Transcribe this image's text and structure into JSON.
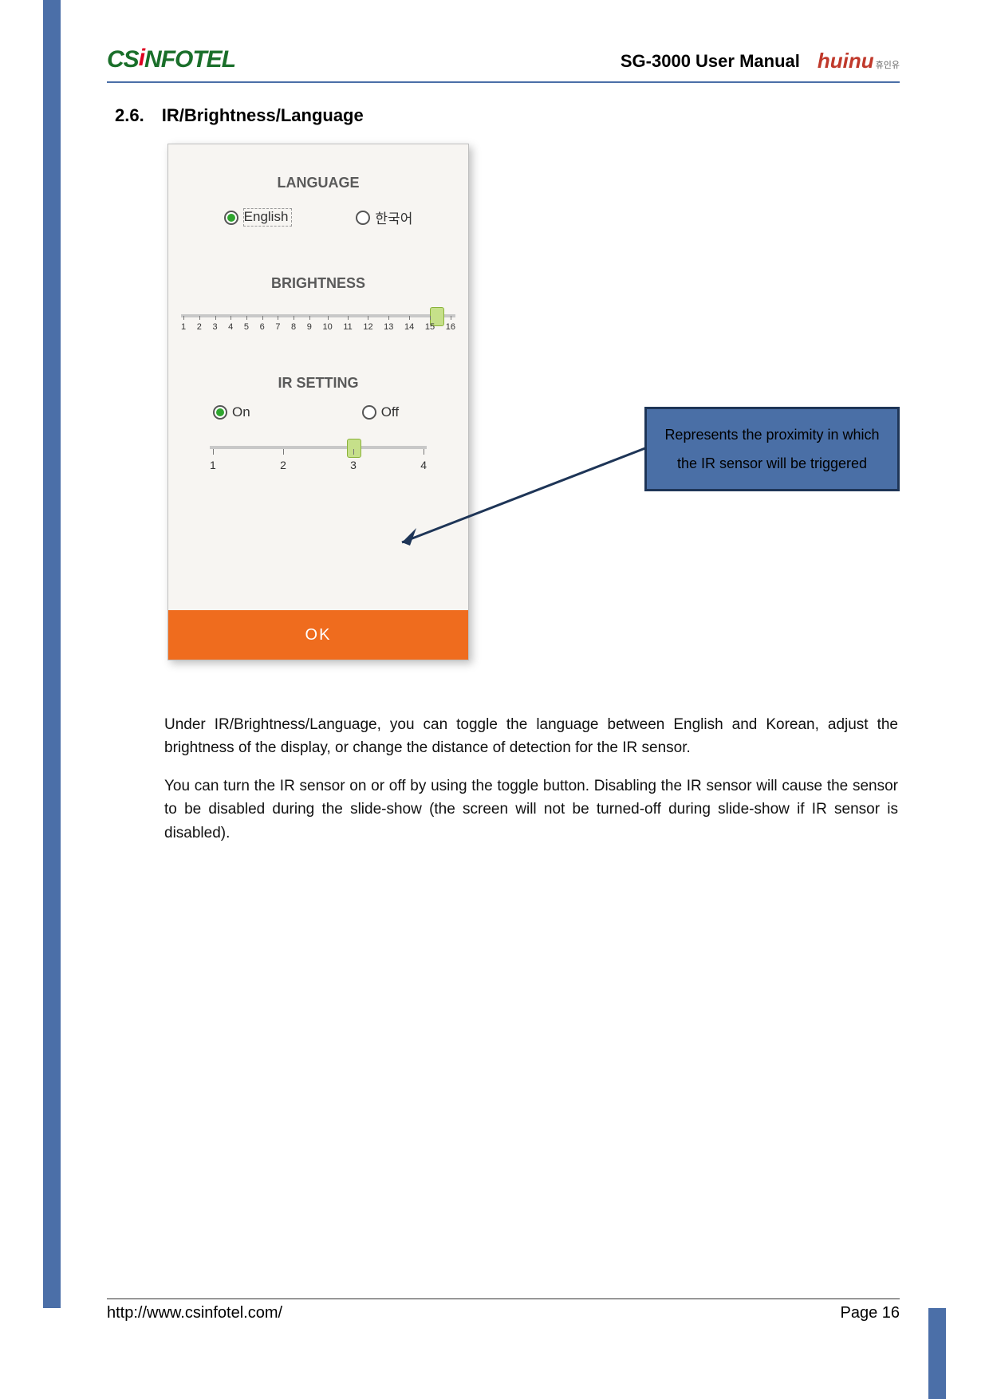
{
  "header": {
    "logo_cs_prefix": "CS",
    "logo_cs_suffix": "NFOTEL",
    "doc_title": "SG-3000 User Manual",
    "logo_huinu": "huinu",
    "logo_huinu_kr": "휴인유"
  },
  "section": {
    "number": "2.6.",
    "title": "IR/Brightness/Language"
  },
  "phone": {
    "language": {
      "heading": "LANGUAGE",
      "opt_english": "English",
      "opt_korean": "한국어"
    },
    "brightness": {
      "heading": "BRIGHTNESS",
      "ticks": [
        "1",
        "2",
        "3",
        "4",
        "5",
        "6",
        "7",
        "8",
        "9",
        "10",
        "11",
        "12",
        "13",
        "14",
        "15",
        "16"
      ],
      "value": 15
    },
    "ir": {
      "heading": "IR SETTING",
      "opt_on": "On",
      "opt_off": "Off",
      "ticks": [
        "1",
        "2",
        "3",
        "4"
      ],
      "value": 3
    },
    "ok": "OK"
  },
  "callout": "Represents the proximity in which the IR sensor will be triggered",
  "body": {
    "p1": "Under IR/Brightness/Language, you can toggle the language between English and Korean, adjust the brightness of the display, or change the distance of detection for the IR sensor.",
    "p2": "You can turn the IR sensor on or off by using the toggle button. Disabling the IR sensor will cause the sensor to be disabled during the slide-show (the screen will not be turned-off during slide-show if IR sensor is disabled)."
  },
  "footer": {
    "url": "http://www.csinfotel.com/",
    "page": "Page 16"
  }
}
